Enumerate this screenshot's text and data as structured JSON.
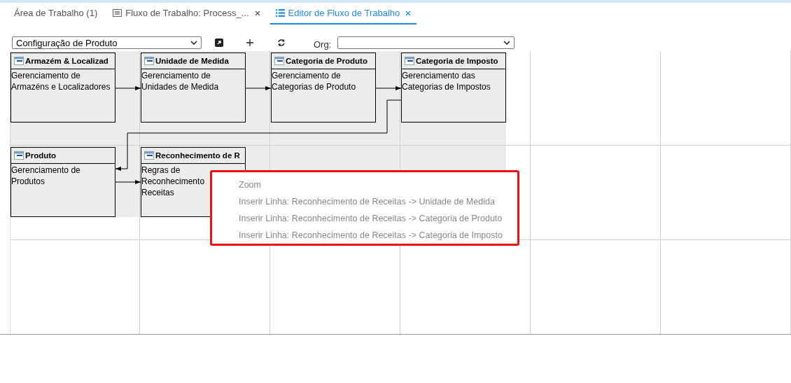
{
  "tabs": [
    {
      "label": "Área de Trabalho (1)",
      "closable": false,
      "selected": false
    },
    {
      "label": "Fluxo de Trabalho: Process_...",
      "closable": true,
      "selected": false
    },
    {
      "label": "Editor de Fluxo de Trabalho",
      "closable": true,
      "selected": true
    }
  ],
  "toolbar": {
    "workflow_select": {
      "value": "Configuração de Produto"
    },
    "org_label": "Org:"
  },
  "diagram": {
    "nodes": [
      {
        "title": "Armazém & Localizad",
        "lines": [
          "Gerenciamento de",
          "Armazéns e Localizadores"
        ]
      },
      {
        "title": "Unidade de Medida",
        "lines": [
          "Gerenciamento de",
          "Unidades de Medida"
        ]
      },
      {
        "title": "Categoria de Produto",
        "lines": [
          "Gerenciamento de",
          "Categorias de Produto"
        ]
      },
      {
        "title": "Categoria de Imposto",
        "lines": [
          "Gerenciamento das",
          "Categorias de Impostos"
        ]
      },
      {
        "title": "Produto",
        "lines": [
          "Gerenciamento de",
          "Produtos"
        ]
      },
      {
        "title": "Reconhecimento de R",
        "lines": [
          "Regras de",
          "Reconhecimento",
          "Receitas"
        ]
      }
    ]
  },
  "context_menu": {
    "items": [
      {
        "label": "Zoom",
        "disabled": true
      },
      {
        "label": "Inserir Linha: Reconhecimento de Receitas -> Unidade de Medida",
        "disabled": true
      },
      {
        "label": "Inserir Linha: Reconhecimento de Receitas -> Categoria de Produto",
        "disabled": true
      },
      {
        "label": "Inserir Linha: Reconhecimento de Receitas -> Categoria de Imposto",
        "disabled": true
      }
    ]
  }
}
